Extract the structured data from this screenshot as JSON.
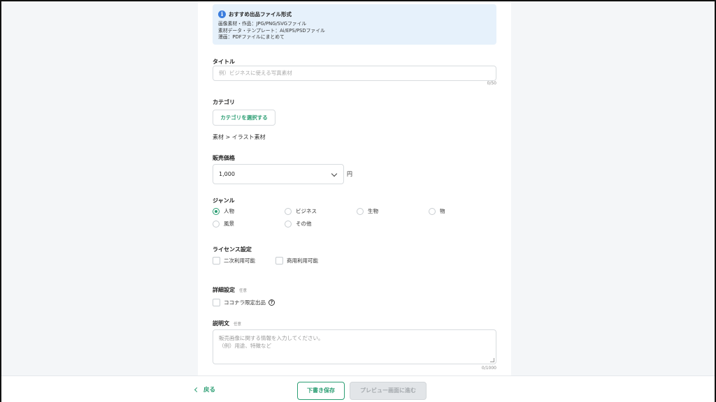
{
  "info": {
    "title": "おすすめ出品ファイル形式",
    "lines": [
      "画像素材・作品：JPG/PNG/SVGファイル",
      "素材データ・テンプレート：Ai/EPS/PSDファイル",
      "漫画：PDFファイルにまとめて"
    ]
  },
  "title_field": {
    "label": "タイトル",
    "placeholder": "例）ビジネスに使える写真素材",
    "counter": "0/50"
  },
  "category": {
    "label": "カテゴリ",
    "button": "カテゴリを選択する",
    "path": "素材 > イラスト素材"
  },
  "price": {
    "label": "販売価格",
    "value": "1,000",
    "unit": "円"
  },
  "genre": {
    "label": "ジャンル",
    "options": [
      "人物",
      "ビジネス",
      "生物",
      "物",
      "風景",
      "その他"
    ],
    "selected": "人物"
  },
  "license": {
    "label": "ライセンス設定",
    "options": [
      "二次利用可能",
      "商用利用可能"
    ]
  },
  "detail": {
    "label": "詳細設定",
    "optional": "任意",
    "option": "ココナラ限定出品"
  },
  "description": {
    "label": "説明文",
    "optional": "任意",
    "placeholder_line1": "販売画像に関する情報を入力してください。",
    "placeholder_line2": "（例）用途、特徴など",
    "counter": "0/1000"
  },
  "footer": {
    "back": "戻る",
    "draft": "下書き保存",
    "preview": "プレビュー画面に進む"
  },
  "colors": {
    "accent": "#2c9e73",
    "info_bg": "#e6f1fb",
    "info_icon": "#3b7ddd"
  }
}
